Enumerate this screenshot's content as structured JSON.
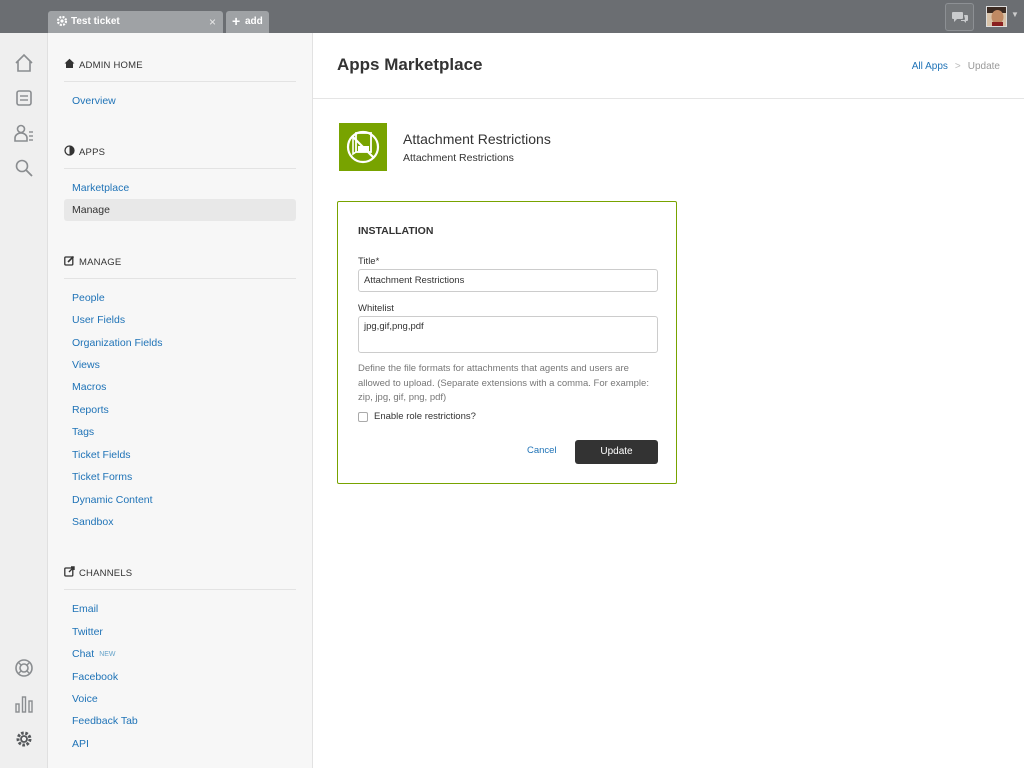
{
  "topbar": {
    "tabs": [
      {
        "label": "Test ticket",
        "close": "×"
      },
      {
        "label": "add",
        "icon": "+"
      }
    ],
    "icons": [
      "chat-icon",
      "user-avatar"
    ]
  },
  "rail": {
    "icons": [
      "home-icon",
      "views-icon",
      "customers-icon",
      "search-icon",
      "help-center-icon",
      "reporting-icon",
      "admin-gear-icon"
    ]
  },
  "admin_nav": {
    "admin_home": {
      "heading": "ADMIN HOME",
      "items": [
        "Overview"
      ]
    },
    "apps": {
      "heading": "APPS",
      "items": [
        "Marketplace",
        "Manage"
      ],
      "active": "Manage"
    },
    "manage": {
      "heading": "MANAGE",
      "items": [
        "People",
        "User Fields",
        "Organization Fields",
        "Views",
        "Macros",
        "Reports",
        "Tags",
        "Ticket Fields",
        "Ticket Forms",
        "Dynamic Content",
        "Sandbox"
      ]
    },
    "channels": {
      "heading": "CHANNELS",
      "items": [
        "Email",
        "Twitter",
        "Chat",
        "Facebook",
        "Voice",
        "Feedback Tab",
        "API"
      ],
      "chat_badge": "NEW"
    }
  },
  "main": {
    "title": "Apps Marketplace",
    "breadcrumb": {
      "link": "All Apps",
      "separator": ">",
      "current": "Update"
    },
    "app": {
      "name": "Attachment Restrictions",
      "subtitle": "Attachment Restrictions",
      "logo_color": "#78a300"
    },
    "installation": {
      "heading": "INSTALLATION",
      "title_label": "Title*",
      "title_value": "Attachment Restrictions",
      "whitelist_label": "Whitelist",
      "whitelist_value": "jpg,gif,png,pdf",
      "help": "Define the file formats for attachments that agents and users are allowed to upload. (Separate extensions with a comma. For example: zip, jpg, gif, png, pdf)",
      "role_checkbox_label": "Enable role restrictions?",
      "role_checked": false,
      "cancel_label": "Cancel",
      "update_label": "Update"
    }
  },
  "colors": {
    "accent_green": "#78a300",
    "link_blue": "#1f73b7",
    "topbar": "#6b6e72",
    "primary_button": "#333333"
  }
}
